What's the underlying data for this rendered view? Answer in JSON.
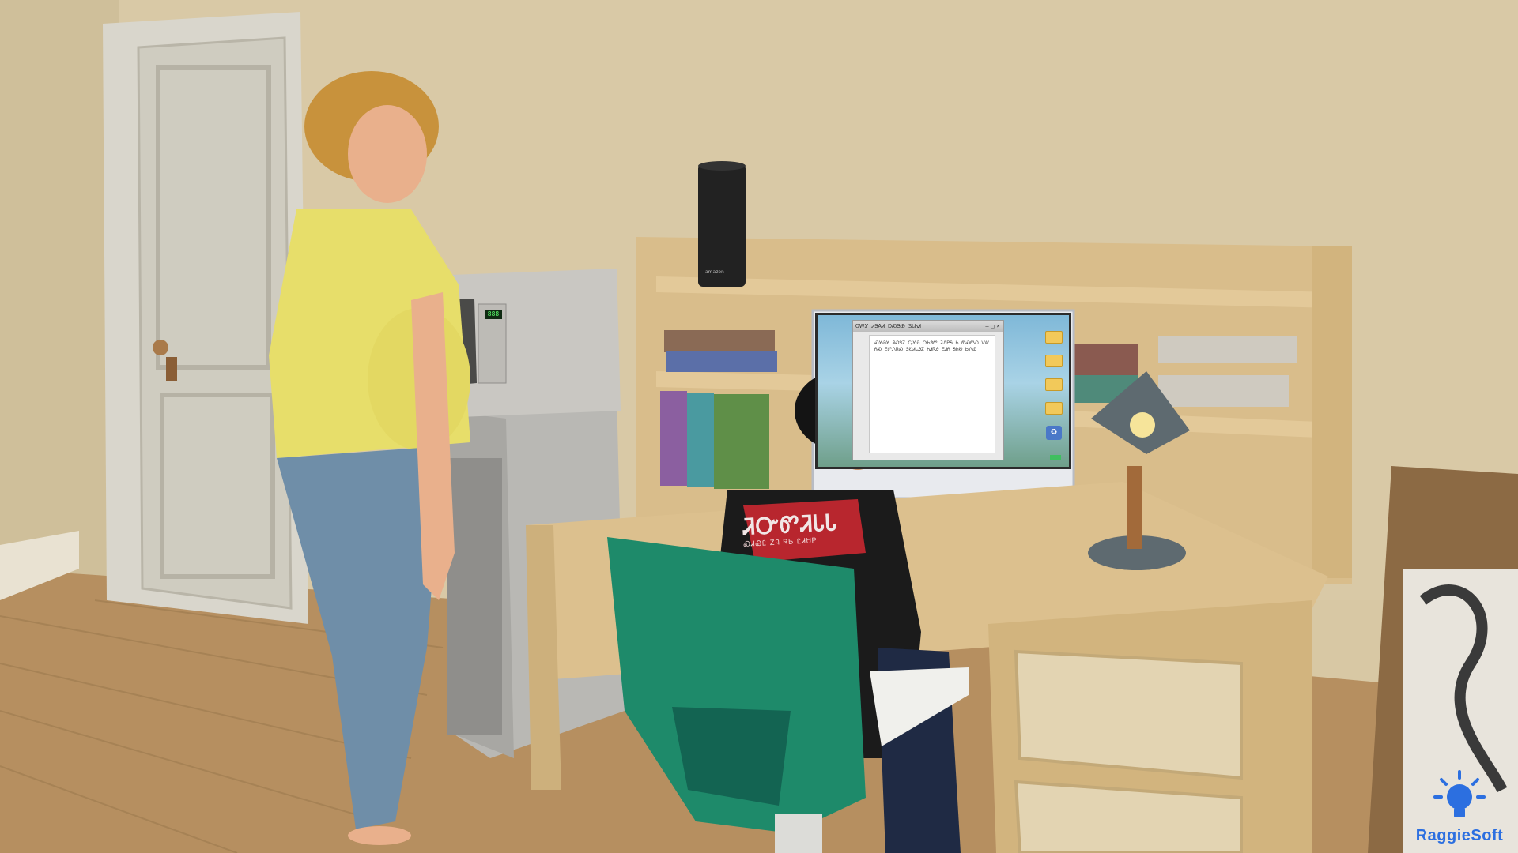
{
  "scene": {
    "type": "game-screenshot"
  },
  "monitor": {
    "window_title": "ᏣᎳᎩ ᏗᎦᎪᏗ ᎠᏍᎦᏯ ᏚᏓᏂᏗ",
    "window_controls": [
      "–",
      "□",
      "×"
    ],
    "document_text": "ᏍᎩᏯᎩ ᏘᏍᏕᏃ ᏩᎩᏯ ᎤᏂᏕᏛ ᏘᏁᏢᎦ Ꮟ ᏛᏍᏛᏍ ᏙᏔ ᏲᏍ ᎬᏛᏁᏒᏍ ᏚᏬᏗᏓᎯᏃ ᏂᏗᏒᎯ ᎬᏗᏲ ᎦᏂᎧ ᏏᏁᏯ",
    "dock_icon_names": [
      "folder-icon",
      "folder-icon",
      "folder-icon",
      "folder-icon",
      "recycle-bin-icon"
    ]
  },
  "shirt": {
    "print_main": "ᏘᏅᏛᏘᏓᏓ",
    "print_sub": "ᏍᏗᏊᏝ ᏃᎸ ᏒᏏ ᏝᏗᏌᏢ"
  },
  "microwave": {
    "display": "888"
  },
  "speaker": {
    "label": "amazon"
  },
  "watermark": {
    "text": "RaggieSoft",
    "icon": "lightbulb-icon",
    "color": "#2c6fe0"
  },
  "colors": {
    "wall": "#d8c8a4",
    "floor": "#b89466",
    "desk": "#d7bd8c",
    "chair": "#1e8a6a",
    "woman_shirt": "#e7de6a",
    "jeans": "#6f8ea8"
  }
}
